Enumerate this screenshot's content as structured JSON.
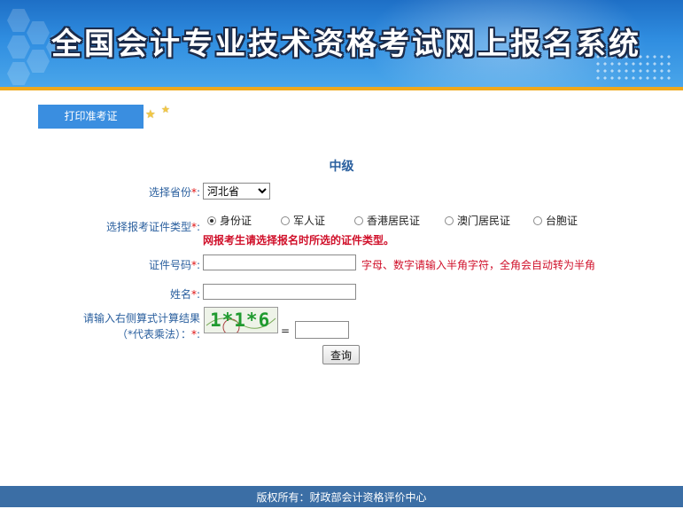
{
  "header": {
    "title": "全国会计专业技术资格考试网上报名系统"
  },
  "toolbar": {
    "print_label": "打印准考证"
  },
  "level": "中级",
  "form": {
    "province": {
      "label": "选择省份",
      "required_mark": "*",
      "colon": ":",
      "selected": "河北省"
    },
    "id_type": {
      "label": "选择报考证件类型",
      "required_mark": "*",
      "colon": ":",
      "options": [
        {
          "label": "身份证",
          "checked": true
        },
        {
          "label": "军人证",
          "checked": false
        },
        {
          "label": "香港居民证",
          "checked": false
        },
        {
          "label": "澳门居民证",
          "checked": false
        },
        {
          "label": "台胞证",
          "checked": false
        }
      ],
      "warning": "网报考生请选择报名时所选的证件类型。"
    },
    "id_number": {
      "label": "证件号码",
      "required_mark": "*",
      "colon": ":",
      "value": "",
      "hint": "字母、数字请输入半角字符，全角会自动转为半角"
    },
    "name": {
      "label": "姓名",
      "required_mark": "*",
      "colon": ":",
      "value": ""
    },
    "captcha": {
      "label_line1": "请输入右侧算式计算结果",
      "label_line2": "（*代表乘法）：",
      "required_mark": "*",
      "colon": ":",
      "image_text": "1*1*6",
      "equals": "=",
      "value": ""
    },
    "submit_label": "查询"
  },
  "footer": {
    "text": "版权所有：财政部会计资格评价中心"
  },
  "colors": {
    "banner": "#2f8de0",
    "accent_stripe": "#f0a81a",
    "label": "#2a5f9e",
    "required": "#e01010",
    "footer": "#3b6ea5"
  }
}
